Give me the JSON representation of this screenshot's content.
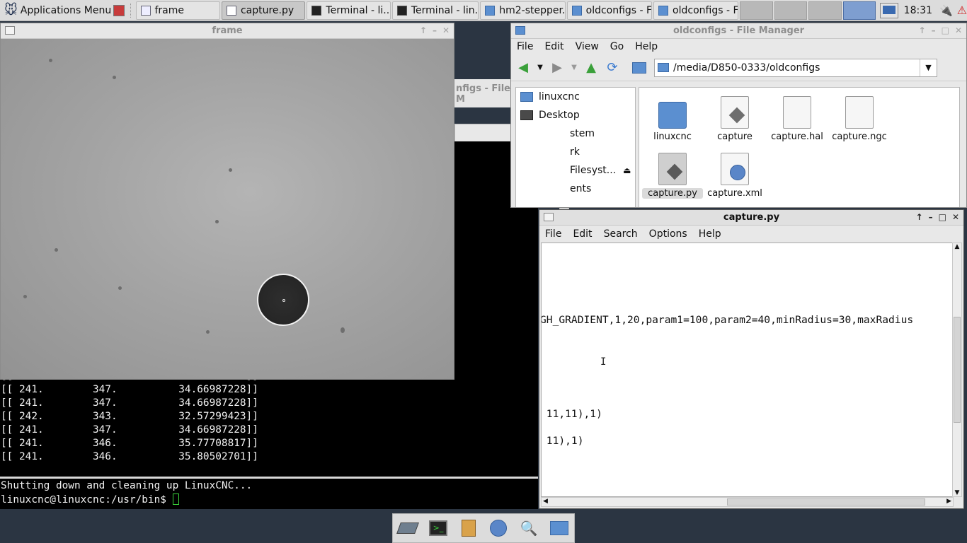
{
  "panel": {
    "app_menu": "Applications Menu",
    "tasks": [
      {
        "label": "frame",
        "active": false
      },
      {
        "label": "capture.py",
        "active": true
      },
      {
        "label": "Terminal - li...",
        "active": false
      },
      {
        "label": "Terminal - lin...",
        "active": false
      },
      {
        "label": "hm2-stepper...",
        "active": false
      },
      {
        "label": "oldconfigs - F...",
        "active": false
      },
      {
        "label": "oldconfigs - F...",
        "active": false
      }
    ],
    "clock": "18:31"
  },
  "frame_window": {
    "title": "frame"
  },
  "hidden_window": {
    "title": "nfigs - File M"
  },
  "terminal": {
    "lines": [
      "[[ 241.        347.          33.37317734]]",
      "[[ 241.        347.          34.66987228]]",
      "[[ 241.        347.          34.66987228]]",
      "[[ 242.        343.          32.57299423]]",
      "[[ 241.        347.          34.66987228]]",
      "[[ 241.        346.          35.77708817]]",
      "[[ 241.        346.          35.80502701]]"
    ],
    "shutdown": "Shutting down and cleaning up LinuxCNC...",
    "prompt": "linuxcnc@linuxcnc:/usr/bin$ "
  },
  "file_manager": {
    "title": "oldconfigs - File Manager",
    "menu": [
      "File",
      "Edit",
      "View",
      "Go",
      "Help"
    ],
    "location": "/media/D850-0333/oldconfigs",
    "sidebar": [
      "linuxcnc",
      "Desktop",
      "stem",
      "rk",
      "Filesyst...",
      "ents"
    ],
    "files": [
      {
        "name": "linuxcnc",
        "kind": "folder"
      },
      {
        "name": "capture",
        "kind": "script"
      },
      {
        "name": "capture.hal",
        "kind": "text"
      },
      {
        "name": "capture.ngc",
        "kind": "text"
      },
      {
        "name": "capture.py",
        "kind": "script",
        "selected": true
      },
      {
        "name": "capture.xml",
        "kind": "xml"
      }
    ]
  },
  "editor": {
    "title": "capture.py",
    "menu": [
      "File",
      "Edit",
      "Search",
      "Options",
      "Help"
    ],
    "lines": [
      "GH_GRADIENT,1,20,param1=100,param2=40,minRadius=30,maxRadius",
      " 11,11),1)",
      " 11),1)"
    ]
  },
  "colors": {
    "desktop": "#2b3542",
    "terminal_bg": "#000000",
    "panel_bg": "#dcdcdc"
  }
}
